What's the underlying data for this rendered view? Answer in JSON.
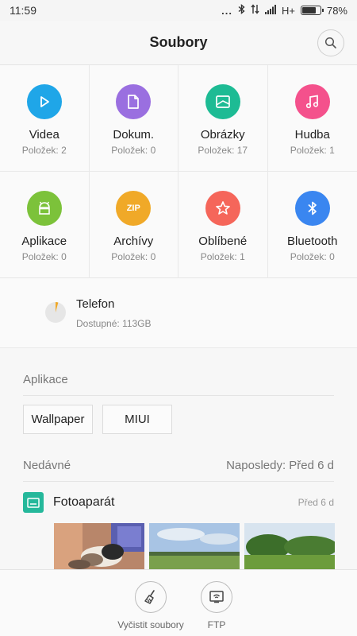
{
  "status": {
    "time": "11:59",
    "dots": "...",
    "network": "H+",
    "battery": "78%",
    "battery_level": 0.78
  },
  "header": {
    "title": "Soubory"
  },
  "categories": [
    {
      "label": "Videa",
      "count": "Položek: 2",
      "color": "#1fa6e8",
      "icon": "play-icon"
    },
    {
      "label": "Dokum.",
      "count": "Položek: 0",
      "color": "#9a6fe0",
      "icon": "document-icon"
    },
    {
      "label": "Obrázky",
      "count": "Položek: 17",
      "color": "#1dbb94",
      "icon": "image-icon"
    },
    {
      "label": "Hudba",
      "count": "Položek: 1",
      "color": "#f4518c",
      "icon": "music-note-icon"
    },
    {
      "label": "Aplikace",
      "count": "Položek: 0",
      "color": "#7cc23a",
      "icon": "android-icon"
    },
    {
      "label": "Archívy",
      "count": "Položek: 0",
      "color": "#f0a928",
      "icon": "zip-icon",
      "icon_text": "ZIP"
    },
    {
      "label": "Oblíbené",
      "count": "Položek: 1",
      "color": "#f5665a",
      "icon": "star-icon"
    },
    {
      "label": "Bluetooth",
      "count": "Položek: 0",
      "color": "#3a86f0",
      "icon": "bluetooth-icon"
    }
  ],
  "storage": {
    "name": "Telefon",
    "free": "Dostupné: 113GB",
    "used_color": "#f0a928"
  },
  "apps_section": {
    "title": "Aplikace",
    "chips": [
      "Wallpaper",
      "MIUI"
    ]
  },
  "recent_section": {
    "title": "Nedávné",
    "last": "Naposledy: Před 6 d",
    "folder": {
      "name": "Fotoaparát",
      "time": "Před 6 d",
      "color": "#25b89b"
    }
  },
  "bottom": {
    "clean": "Vyčistit soubory",
    "ftp": "FTP"
  }
}
